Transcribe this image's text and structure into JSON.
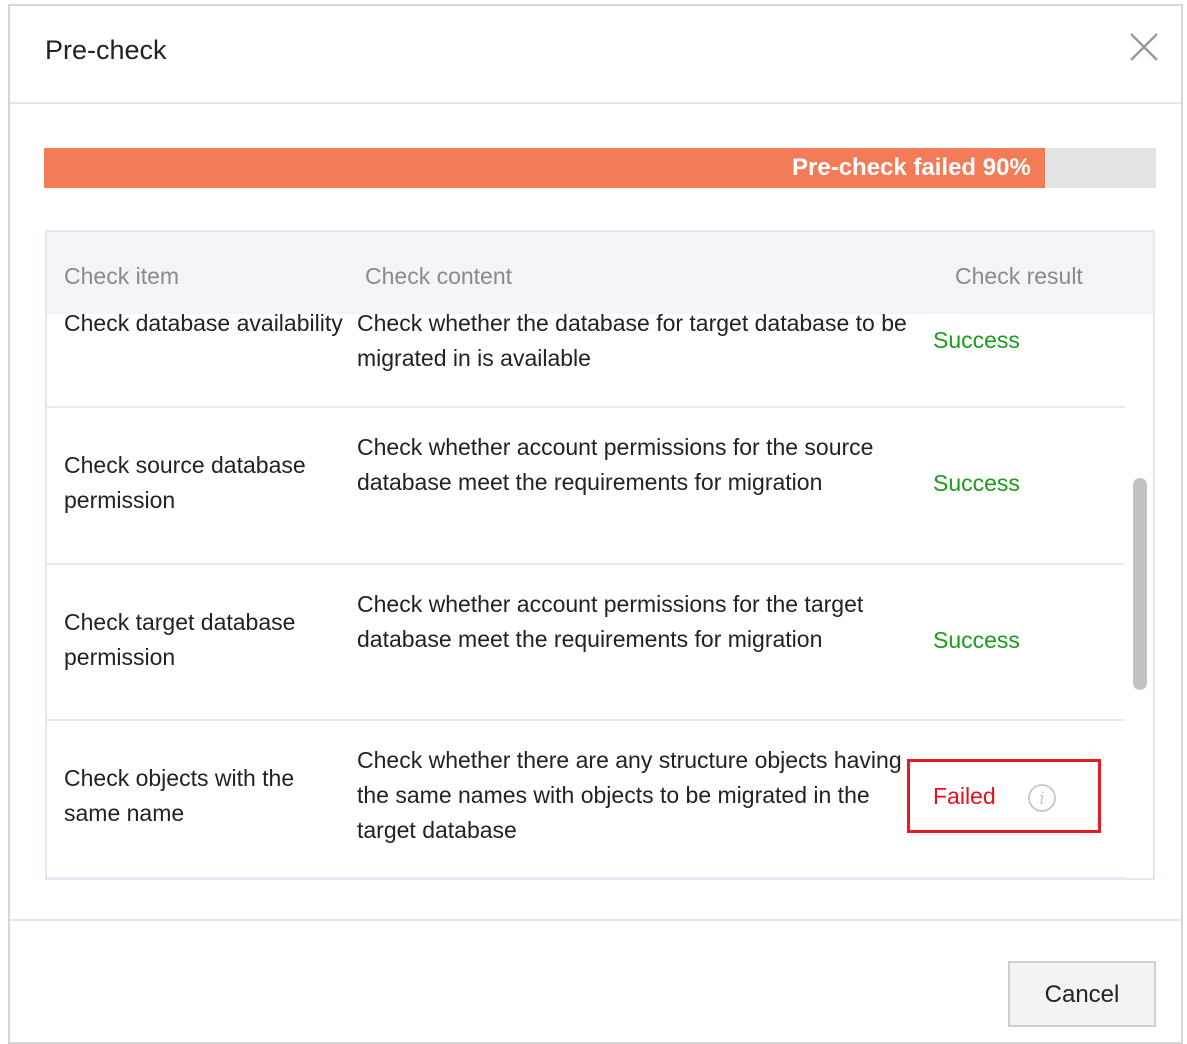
{
  "dialog": {
    "title": "Pre-check",
    "close_icon": "close-icon"
  },
  "progress": {
    "label": "Pre-check failed 90%",
    "percent": 90,
    "fill_color": "#f47b57",
    "track_color": "#e3e3e6"
  },
  "table": {
    "headers": {
      "item": "Check item",
      "content": "Check content",
      "result": "Check result"
    },
    "rows": [
      {
        "item": "Check database availability",
        "content": "Check whether the database for target database to be migrated in is available",
        "result": "Success"
      },
      {
        "item": "Check source database permission",
        "content": "Check whether account permissions for the source database meet the requirements for migration",
        "result": "Success"
      },
      {
        "item": "Check target database permission",
        "content": "Check whether account permissions for the target database meet the requirements for migration",
        "result": "Success"
      },
      {
        "item": "Check objects with the same name",
        "content": "Check whether there are any structure objects having the same names with objects to be migrated in the target database",
        "result": "Failed",
        "result_icon": "info-icon"
      }
    ],
    "success_color": "#1a9c1a",
    "failed_color": "#e8101a"
  },
  "footer": {
    "cancel_label": "Cancel"
  }
}
